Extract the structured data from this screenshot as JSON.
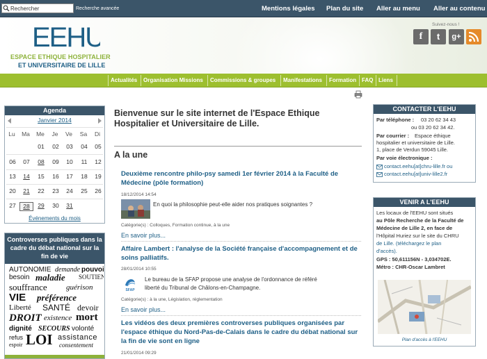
{
  "topbar": {
    "search_value": "Rechercher",
    "advanced_search": "Recherche avancée",
    "links": [
      "Mentions légales",
      "Plan du site",
      "Aller au menu",
      "Aller au contenu"
    ]
  },
  "header": {
    "logo_text": "EEHU",
    "org_line1": "ESPACE ETHIQUE HOSPITALIER",
    "org_line2": "ET UNIVERSITAIRE DE LILLE",
    "follow_label": "Suivez-nous !",
    "social": [
      {
        "name": "facebook-icon",
        "glyph": "f",
        "color": "#6b6b6b"
      },
      {
        "name": "twitter-icon",
        "glyph": "t",
        "color": "#6b6b6b"
      },
      {
        "name": "googleplus-icon",
        "glyph": "g+",
        "color": "#6b6b6b"
      },
      {
        "name": "rss-icon",
        "glyph": "",
        "color": "#e58a2a"
      }
    ]
  },
  "nav": {
    "items": [
      "Actualités",
      "Organisation Missions",
      "Commissions & groupes",
      "Manifestations",
      "Formation",
      "FAQ",
      "Liens"
    ]
  },
  "agenda": {
    "title": "Agenda",
    "month": "Janvier 2014",
    "day_headers": [
      "Lu",
      "Ma",
      "Me",
      "Je",
      "Ve",
      "Sa",
      "Di"
    ],
    "weeks": [
      [
        "",
        "",
        "01",
        "02",
        "03",
        "04",
        "05"
      ],
      [
        "06",
        "07",
        "08",
        "09",
        "10",
        "11",
        "12"
      ],
      [
        "13",
        "14",
        "15",
        "16",
        "17",
        "18",
        "19"
      ],
      [
        "20",
        "21",
        "22",
        "23",
        "24",
        "25",
        "26"
      ],
      [
        "27",
        "28",
        "29",
        "30",
        "31",
        "",
        ""
      ]
    ],
    "events_link": "Événements du mois"
  },
  "controverses": {
    "title": "Controverses publiques dans la cadre du débat national sur la fin de vie",
    "words": [
      "AUTONOMIE",
      "demande",
      "pouvoir",
      "besoin",
      "maladie",
      "SOUTIEN",
      "souffrance",
      "guérison",
      "VIE",
      "préférence",
      "Liberté",
      "SANTÉ",
      "devoir",
      "DROIT",
      "existence",
      "mort",
      "dignité",
      "SECOURS",
      "volonté",
      "refus",
      "espoir",
      "LOI",
      "assistance",
      "consentement"
    ]
  },
  "main": {
    "welcome": "Bienvenue sur le site internet de l'Espace Ethique Hospitalier et Universitaire de Lille.",
    "section_title": "A la une",
    "articles": [
      {
        "title": "Deuxième rencontre philo-psy samedi 1er février 2014 à la Faculté de Médecine (pôle formation)",
        "date": "18/12/2014 14:54",
        "summary": "En quoi la philosophie peut-elle aider nos pratiques soignantes ?",
        "categories": "Catégorie(s) : Colloques, Formation continue, à la une",
        "more": "En savoir plus..."
      },
      {
        "title": "Affaire Lambert : l'analyse de la Société française d'accompagnement et de soins palliatifs.",
        "date": "28/01/2014 10:55",
        "summary_line1": "Le bureau de la SFAP propose une analyse de l'ordonnance de référé",
        "summary_line2": "liberté du Tribunal de Châlons-en-Champagne.",
        "thumb_label": "SFAP",
        "categories": "Catégorie(s) : à la une, Législation, réglementation",
        "more": "En savoir plus..."
      },
      {
        "title": "Les vidéos des deux premières controverses publiques organisées par l'espace éthique du Nord-Pas-de-Calais dans le cadre du débat national sur la fin de vie sont en ligne",
        "date": "21/01/2014 09:29"
      }
    ]
  },
  "contact": {
    "title": "CONTACTER L'EEHU",
    "phone_label": "Par téléphone :",
    "phone1": "03 20 62 34 43",
    "phone2": "ou 03 20 62 34 42.",
    "mail_label": "Par courrier :",
    "mail_line1": "Espace éthique",
    "mail_line2": "hospitalier et universitaire de Lille.",
    "mail_line3": "1, place de Verdun 59045 Lille.",
    "email_label": "Par voie électronique :",
    "email1": "contact.eehu[at]chru-lille.fr ou",
    "email2": "contact.eehu[at]univ-lille2.fr"
  },
  "venir": {
    "title": "VENIR A L'EEHU",
    "lines": [
      "Les locaux de l'EEHU sont situés",
      "au Pôle Recherche de la Faculté de",
      "Médecine de Lille 2, en face de",
      "l'Hôpital Huriez sur le site du CHRU",
      "de Lille. (téléchargez le plan",
      "d'accès)."
    ],
    "gps": "GPS : 50,611156N - 3,034702E.",
    "metro": "Métro : CHR-Oscar Lambret",
    "map_caption": "Plan d'accès à l'EEHU"
  }
}
